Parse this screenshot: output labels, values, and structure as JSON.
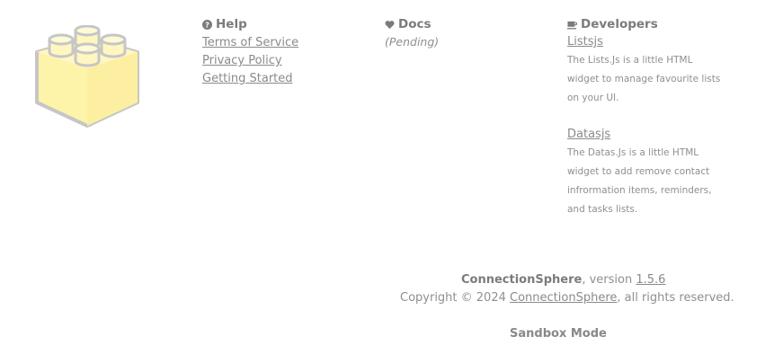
{
  "logo": {
    "icon": "lego-brick-icon",
    "color": "#fdf3a9"
  },
  "help": {
    "title": "Help",
    "icon": "question-circle-icon",
    "links": [
      "Terms of Service",
      "Privacy Policy",
      "Getting Started"
    ]
  },
  "docs": {
    "title": "Docs",
    "icon": "heart-icon",
    "status": "(Pending)"
  },
  "developers": {
    "title": "Developers",
    "icon": "coffee-cup-icon",
    "items": [
      {
        "name": "Listsjs",
        "description": "The Lists.Js is a little HTML widget to manage favourite lists on your UI."
      },
      {
        "name": "Datasjs",
        "description": "The Datas.Js is a little HTML widget to add remove contact infrormation items, reminders, and tasks lists."
      }
    ]
  },
  "footer": {
    "app_name": "ConnectionSphere",
    "version_prefix": ", version ",
    "version": "1.5.6",
    "copyright_prefix": "Copyright © 2024 ",
    "copyright_link": "ConnectionSphere",
    "copyright_suffix": ", all rights reserved.",
    "mode": "Sandbox Mode"
  }
}
